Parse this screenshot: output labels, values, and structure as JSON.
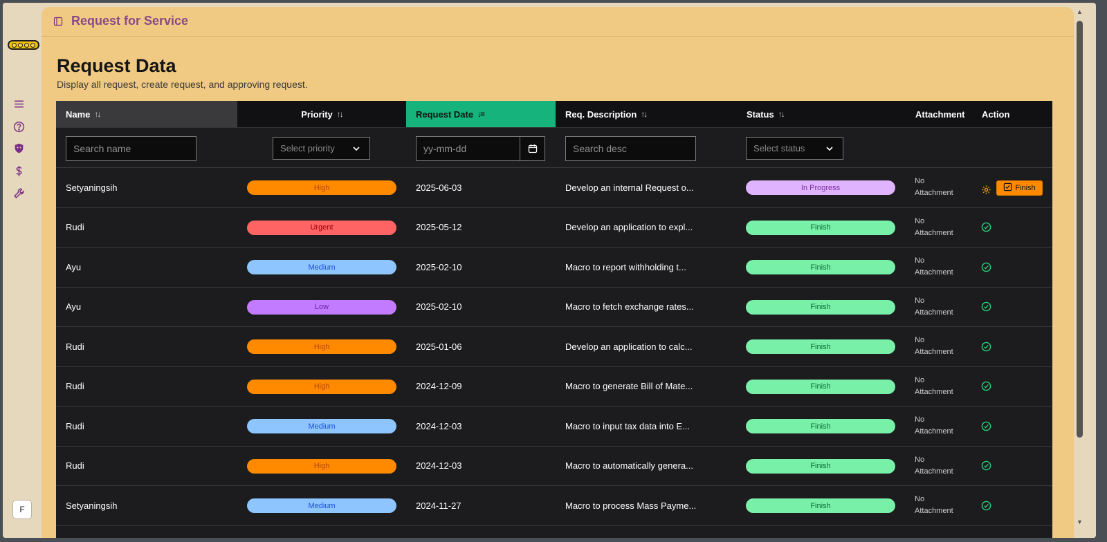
{
  "app": {
    "title": "Request for Service"
  },
  "page": {
    "title": "Request Data",
    "subtitle": "Display all request, create request, and approving request."
  },
  "user": {
    "initial": "F"
  },
  "sidebar": {
    "icons": [
      "menu-icon",
      "help-icon",
      "shield-icon",
      "dollar-icon",
      "wrench-icon"
    ]
  },
  "table": {
    "headers": {
      "name": "Name",
      "priority": "Priority",
      "date": "Request Date",
      "desc": "Req. Description",
      "status": "Status",
      "attachment": "Attachment",
      "action": "Action"
    },
    "filters": {
      "name_placeholder": "Search name",
      "priority_placeholder": "Select priority",
      "date_placeholder": "yy-mm-dd",
      "desc_placeholder": "Search desc",
      "status_placeholder": "Select status"
    },
    "rows": [
      {
        "name": "Setyaningsih",
        "priority": "High",
        "date": "2025-06-03",
        "desc": "Develop an internal Request o...",
        "status": "In Progress",
        "att1": "No",
        "att2": "Attachment",
        "action": "Finish"
      },
      {
        "name": "Rudi",
        "priority": "Urgent",
        "date": "2025-05-12",
        "desc": "Develop an application to expl...",
        "status": "Finish",
        "att1": "No",
        "att2": "Attachment"
      },
      {
        "name": "Ayu",
        "priority": "Medium",
        "date": "2025-02-10",
        "desc": "Macro to report withholding t...",
        "status": "Finish",
        "att1": "No",
        "att2": "Attachment"
      },
      {
        "name": "Ayu",
        "priority": "Low",
        "date": "2025-02-10",
        "desc": "Macro to fetch exchange rates...",
        "status": "Finish",
        "att1": "No",
        "att2": "Attachment"
      },
      {
        "name": "Rudi",
        "priority": "High",
        "date": "2025-01-06",
        "desc": "Develop an application to calc...",
        "status": "Finish",
        "att1": "No",
        "att2": "Attachment"
      },
      {
        "name": "Rudi",
        "priority": "High",
        "date": "2024-12-09",
        "desc": "Macro to generate Bill of Mate...",
        "status": "Finish",
        "att1": "No",
        "att2": "Attachment"
      },
      {
        "name": "Rudi",
        "priority": "Medium",
        "date": "2024-12-03",
        "desc": "Macro to input tax data into E...",
        "status": "Finish",
        "att1": "No",
        "att2": "Attachment"
      },
      {
        "name": "Rudi",
        "priority": "High",
        "date": "2024-12-03",
        "desc": "Macro to automatically genera...",
        "status": "Finish",
        "att1": "No",
        "att2": "Attachment"
      },
      {
        "name": "Setyaningsih",
        "priority": "Medium",
        "date": "2024-11-27",
        "desc": "Macro to process Mass Payme...",
        "status": "Finish",
        "att1": "No",
        "att2": "Attachment"
      }
    ]
  },
  "colors": {
    "High": "#ff8a00",
    "Urgent": "#ff6464",
    "Medium": "#8ec5ff",
    "Low": "#c27bff",
    "High_text": "#b04a00",
    "Urgent_text": "#a00000",
    "Medium_text": "#1d4ed8",
    "Low_text": "#6b21a8",
    "In Progress": "#e0b3ff",
    "Finish": "#78f0a8",
    "In Progress_text": "#7a2fa0",
    "Finish_text": "#0a6b36"
  }
}
